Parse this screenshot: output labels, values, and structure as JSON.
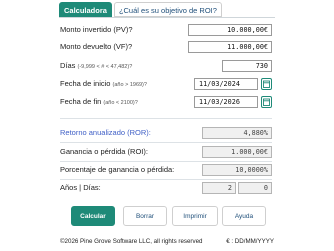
{
  "tabs": [
    {
      "label": "Calculadora",
      "active": true
    },
    {
      "label": "¿Cuál es su objetivo de ROI?",
      "active": false
    }
  ],
  "fields": {
    "pv": {
      "label": "Monto invertido (PV)?",
      "value": "10.000,00€"
    },
    "fv": {
      "label": "Monto devuelto (VF)?",
      "value": "11.000,00€"
    },
    "days": {
      "label": "Días",
      "hint": "(-9,999 < # < 47,482)?",
      "value": "730"
    },
    "start_date": {
      "label": "Fecha de inicio",
      "hint": "(año > 1969)?",
      "value": "11/03/2024"
    },
    "end_date": {
      "label": "Fecha de fin",
      "hint": "(año < 2100)?",
      "value": "11/03/2026"
    }
  },
  "results": {
    "annual_roi": {
      "label": "Retorno anualizado (ROR):",
      "value": "4,880%"
    },
    "gain": {
      "label": "Ganancia o pérdida (ROI):",
      "value": "1.000,00€"
    },
    "gain_pct": {
      "label": "Porcentaje de ganancia o pérdida:",
      "value": "10,0000%"
    },
    "years_days": {
      "label": "Años | Días:",
      "years": "2",
      "days": "0"
    }
  },
  "buttons": {
    "calculate": "Calcular",
    "clear": "Borrar",
    "print": "Imprimir",
    "help": "Ayuda"
  },
  "footer": {
    "copyright": "©2026 Pine Grove Software LLC, all rights reserved",
    "format": "€ : DD/MM/YYYY"
  },
  "colors": {
    "accent": "#1e8a78",
    "link_blue": "#3f5fc6"
  },
  "icons": {
    "start_date": "calendar-icon",
    "end_date": "calendar-icon"
  }
}
